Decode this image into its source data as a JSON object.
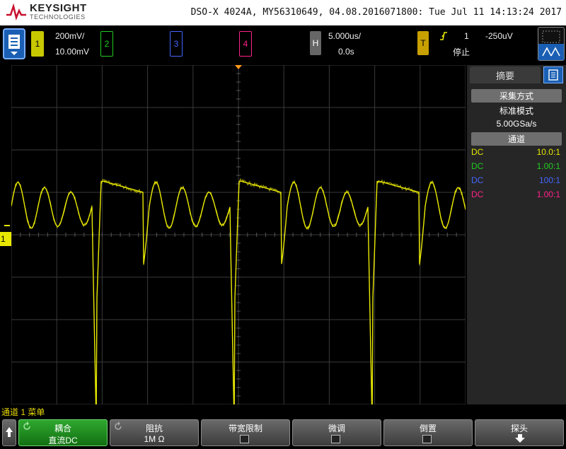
{
  "header": {
    "brand": "KEYSIGHT",
    "brand_sub": "TECHNOLOGIES",
    "model_line": "DSO-X 4024A, MY56310649, 04.08.2016071800: Tue Jul 11 14:13:24 2017"
  },
  "status": {
    "ch1": {
      "num": "1",
      "scale": "200mV/",
      "offset": "10.00mV",
      "color": "#e8e800"
    },
    "ch2": {
      "num": "2",
      "color": "#22cc22"
    },
    "ch3": {
      "num": "3",
      "color": "#4466ff"
    },
    "ch4": {
      "num": "4",
      "color": "#ff2288"
    },
    "horizontal": {
      "label": "H",
      "timebase": "5.000us/",
      "delay": "0.0s"
    },
    "trigger": {
      "label": "T",
      "source": "1",
      "level": "-250uV",
      "state": "停止"
    }
  },
  "ch1_marker": "1",
  "side_panel": {
    "tab": "摘要",
    "acq_header": "采集方式",
    "acq_mode": "标准模式",
    "sample_rate": "5.00GSa/s",
    "channels_header": "通道",
    "channels": [
      {
        "coupling": "DC",
        "ratio": "10.0:1",
        "color": "#e8e800"
      },
      {
        "coupling": "DC",
        "ratio": "1.00:1",
        "color": "#22cc22"
      },
      {
        "coupling": "DC",
        "ratio": "100:1",
        "color": "#4466ff"
      },
      {
        "coupling": "DC",
        "ratio": "1.00:1",
        "color": "#ff2288"
      }
    ]
  },
  "menu_title": "通道 1 菜单",
  "softkeys": [
    {
      "label": "耦合",
      "value": "直流DC",
      "active": true
    },
    {
      "label": "阻抗",
      "value": "1M Ω"
    },
    {
      "label": "带宽限制",
      "checkbox": true
    },
    {
      "label": "微调",
      "checkbox": true
    },
    {
      "label": "倒置",
      "checkbox": true
    },
    {
      "label": "探头"
    }
  ]
}
